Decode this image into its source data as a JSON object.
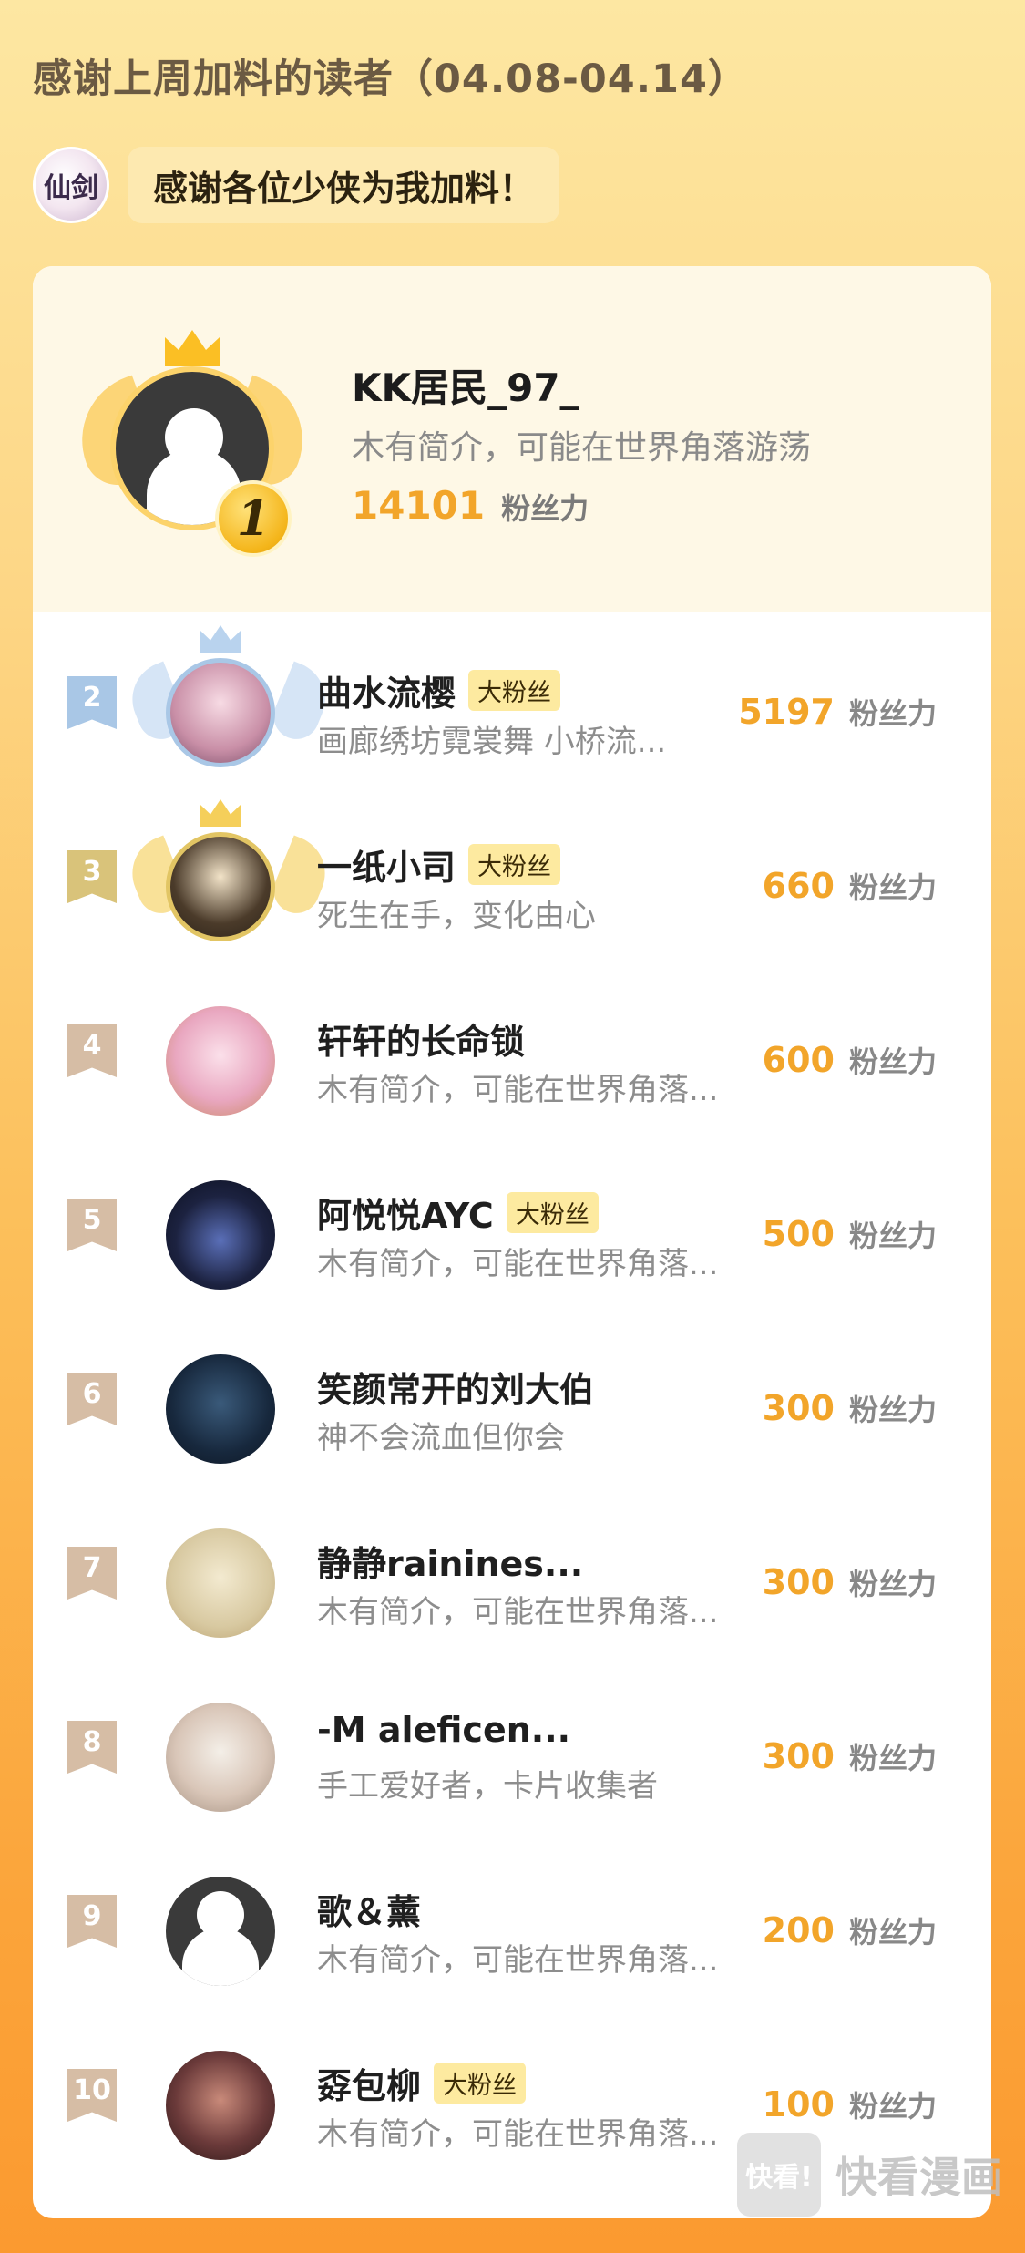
{
  "header": {
    "title": "感谢上周加料的读者（04.08-04.14）",
    "author_avatar_text": "仙剑",
    "author_message": "感谢各位少侠为我加料！"
  },
  "unit_label": "粉丝力",
  "top_reader": {
    "rank": "1",
    "name": "KK居民_97_",
    "bio": "木有简介，可能在世界角落游荡",
    "score": "14101"
  },
  "readers": [
    {
      "rank": "2",
      "name": "曲水流樱",
      "badge": "大粉丝",
      "bio": "画廊绣坊霓裳舞 小桥流...",
      "score": "5197"
    },
    {
      "rank": "3",
      "name": "一纸小司",
      "badge": "大粉丝",
      "bio": "死生在手，变化由心",
      "score": "660"
    },
    {
      "rank": "4",
      "name": "轩轩的长命锁",
      "badge": "",
      "bio": "木有简介，可能在世界角落...",
      "score": "600"
    },
    {
      "rank": "5",
      "name": "阿悦悦AYC",
      "badge": "大粉丝",
      "bio": "木有简介，可能在世界角落...",
      "score": "500"
    },
    {
      "rank": "6",
      "name": "笑颜常开的刘大伯",
      "badge": "",
      "bio": "神不会流血但你会",
      "score": "300"
    },
    {
      "rank": "7",
      "name": "静静rainines...",
      "badge": "",
      "bio": "木有简介，可能在世界角落...",
      "score": "300"
    },
    {
      "rank": "8",
      "name": "-M aleficen...",
      "badge": "",
      "bio": "手工爱好者，卡片收集者",
      "score": "300"
    },
    {
      "rank": "9",
      "name": "歌＆薰",
      "badge": "",
      "bio": "木有简介，可能在世界角落...",
      "score": "200"
    },
    {
      "rank": "10",
      "name": "孬包柳",
      "badge": "大粉丝",
      "bio": "木有简介，可能在世界角落...",
      "score": "100"
    }
  ],
  "colors": {
    "score": "#f2a52a",
    "ribbon_rank2": "#a9c7e6",
    "ribbon_rank3": "#d9c37a",
    "ribbon_other": "#d6bda5"
  },
  "watermark": {
    "box_text": "快看!",
    "text": "快看漫画"
  }
}
